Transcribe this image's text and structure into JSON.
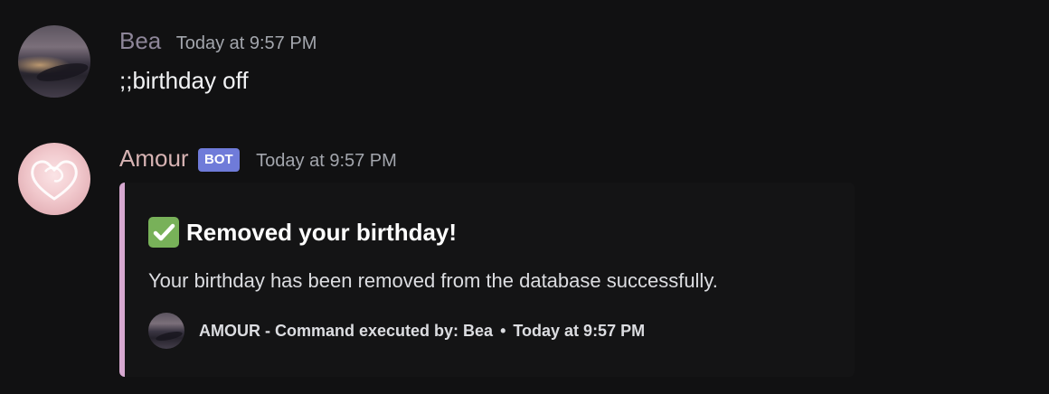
{
  "messages": [
    {
      "author": "Bea",
      "timestamp": "Today at 9:57 PM",
      "content": ";;birthday off"
    },
    {
      "author": "Amour",
      "badge": "BOT",
      "timestamp": "Today at 9:57 PM",
      "embed": {
        "accent_color": "#d6a8d0",
        "icon": "white-check-mark-emoji",
        "title": "Removed your birthday!",
        "description": "Your birthday has been removed from the database successfully.",
        "footer": {
          "text": "AMOUR - Command executed by: Bea",
          "separator": "•",
          "timestamp": "Today at 9:57 PM"
        }
      }
    }
  ]
}
